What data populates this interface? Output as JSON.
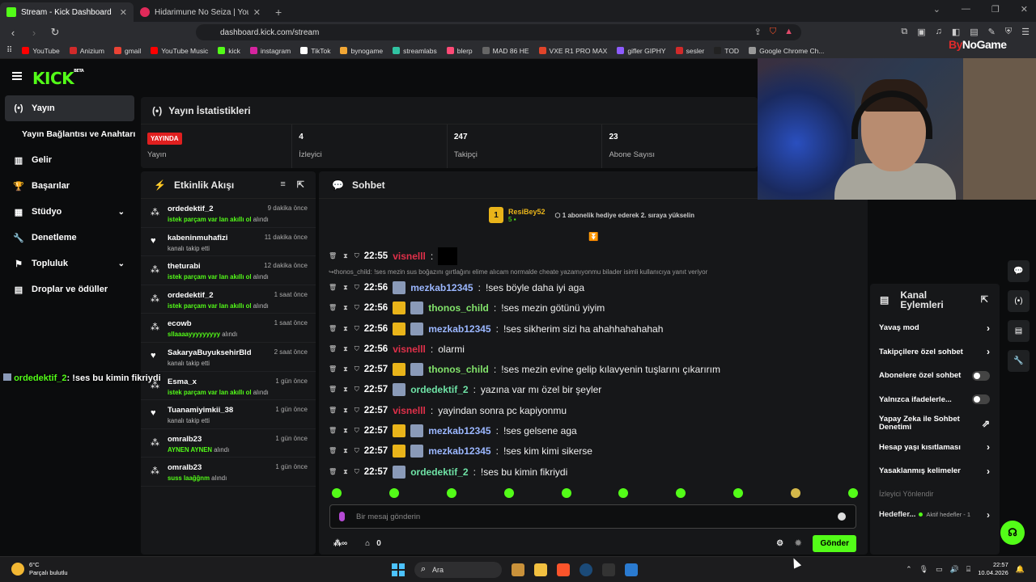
{
  "browser": {
    "tabs": [
      {
        "title": "Stream - Kick Dashboard",
        "active": true,
        "color": "#53fc18"
      },
      {
        "title": "Hidarimune No Seiza | YouTube M",
        "active": false,
        "color": "#e02a5a"
      }
    ],
    "url": "dashboard.kick.com/stream",
    "bookmarks": [
      {
        "label": "YouTube",
        "color": "#ff0000"
      },
      {
        "label": "Anizium",
        "color": "#d12a2a"
      },
      {
        "label": "gmail",
        "color": "#ea4335"
      },
      {
        "label": "YouTube Music",
        "color": "#ff0000"
      },
      {
        "label": "kick",
        "color": "#53fc18"
      },
      {
        "label": "instagram",
        "color": "#d6249f"
      },
      {
        "label": "TikTok",
        "color": "#ffffff"
      },
      {
        "label": "bynogame",
        "color": "#f2a735"
      },
      {
        "label": "streamlabs",
        "color": "#31c3a2"
      },
      {
        "label": "blerp",
        "color": "#ff4a76"
      },
      {
        "label": "MAD 86 HE",
        "color": "#666666"
      },
      {
        "label": "VXE R1 PRO MAX",
        "color": "#e0442a"
      },
      {
        "label": "gifler GIPHY",
        "color": "#8e5cff"
      },
      {
        "label": "sesler",
        "color": "#d12a2a"
      },
      {
        "label": "TOD",
        "color": "#222222"
      },
      {
        "label": "Google Chrome Ch...",
        "color": "#999999"
      }
    ]
  },
  "app": {
    "logo": "KICK",
    "logo_tag": "BETA",
    "sidebar": [
      {
        "label": "Yayın",
        "icon": "broadcast-icon",
        "active": true
      },
      {
        "label": "Yayın Bağlantısı ve Anahtarı",
        "icon": "",
        "sub": true
      },
      {
        "label": "Gelir",
        "icon": "revenue-icon"
      },
      {
        "label": "Başarılar",
        "icon": "trophy-icon"
      },
      {
        "label": "Stüdyo",
        "icon": "studio-icon",
        "chevron": true
      },
      {
        "label": "Denetleme",
        "icon": "wrench-icon"
      },
      {
        "label": "Topluluk",
        "icon": "community-icon",
        "chevron": true
      },
      {
        "label": "Droplar ve ödüller",
        "icon": "drops-icon"
      }
    ],
    "stats": {
      "title": "Yayın İstatistikleri",
      "live_badge": "YAYINDA",
      "live_label": "Yayın",
      "viewers": "4",
      "viewers_label": "İzleyici",
      "followers": "247",
      "followers_label": "Takipçi",
      "subs": "23",
      "subs_label": "Abone Sayısı"
    },
    "brand_overlay": {
      "by": "By",
      "rest": "NoGame"
    },
    "feed": {
      "title": "Etkinlik Akışı",
      "items": [
        {
          "name": "ordedektif_2",
          "time": "9 dakika önce",
          "icon": "reward",
          "desc_green": "istek parçam var lan akıllı ol",
          "desc": " alındı"
        },
        {
          "name": "kabeninmuhafizi",
          "time": "11 dakika önce",
          "icon": "heart",
          "desc_green": "",
          "desc": "kanalı takip etti"
        },
        {
          "name": "theturabi",
          "time": "12 dakika önce",
          "icon": "reward",
          "desc_green": "istek parçam var lan akıllı ol",
          "desc": " alındı"
        },
        {
          "name": "ordedektif_2",
          "time": "1 saat önce",
          "icon": "reward",
          "desc_green": "istek parçam var lan akıllı ol",
          "desc": " alındı"
        },
        {
          "name": "ecowb",
          "time": "1 saat önce",
          "icon": "reward",
          "desc_green": "sllaaaayyyyyyyyy",
          "desc": " alındı"
        },
        {
          "name": "SakaryaBuyuksehirBld",
          "time": "2 saat önce",
          "icon": "heart",
          "desc_green": "",
          "desc": "kanalı takip etti"
        },
        {
          "name": "Esma_x",
          "time": "1 gün önce",
          "icon": "reward",
          "desc_green": "istek parçam var lan akıllı ol",
          "desc": " alındı"
        },
        {
          "name": "Tuanamiyimkii_38",
          "time": "1 gün önce",
          "icon": "heart",
          "desc_green": "",
          "desc": "kanalı takip etti"
        },
        {
          "name": "omralb23",
          "time": "1 gün önce",
          "icon": "reward",
          "desc_green": "AYNEN AYNEN",
          "desc": " alındı"
        },
        {
          "name": "omralb23",
          "time": "1 gün önce",
          "icon": "reward",
          "desc_green": "suss laağğnm",
          "desc": " alındı"
        }
      ]
    },
    "chat": {
      "title": "Sohbet",
      "pinned": {
        "badge": "1",
        "name": "ResiBey52",
        "sub": "5",
        "message": "1 abonelik hediye ederek 2. sıraya yükselin"
      },
      "reply_note": "thonos_child: !ses mezin sus boğazını gırtlağını elime alıcam normalde cheate yazamıyonmu bilader isimli kullanıcıya yanıt veriyor",
      "messages": [
        {
          "time": "22:55",
          "user": "visnelll",
          "color": "#e0304a",
          "text": "",
          "badges": [],
          "black": true
        },
        {
          "time": "22:56",
          "user": "mezkab12345",
          "color": "#9bb7ff",
          "text": "!ses böyle daha iyi aga",
          "badges": [
            "av"
          ]
        },
        {
          "time": "22:56",
          "user": "thonos_child",
          "color": "#82e36b",
          "text": "!ses mezin götünü yiyim",
          "badges": [
            "crown",
            "av"
          ]
        },
        {
          "time": "22:56",
          "user": "mezkab12345",
          "color": "#9bb7ff",
          "text": "!ses sikherim sizi ha ahahhahahahah",
          "badges": [
            "crown",
            "av"
          ]
        },
        {
          "time": "22:56",
          "user": "visnelll",
          "color": "#e0304a",
          "text": "olarmi",
          "badges": []
        },
        {
          "time": "22:57",
          "user": "thonos_child",
          "color": "#82e36b",
          "text": "!ses mezin evine gelip kılavyenin tuşlarını çıkarırım",
          "badges": [
            "crown",
            "av"
          ]
        },
        {
          "time": "22:57",
          "user": "ordedektif_2",
          "color": "#6fe3a6",
          "text": "yazına var mı özel bir şeyler",
          "badges": [
            "av"
          ]
        },
        {
          "time": "22:57",
          "user": "visnelll",
          "color": "#e0304a",
          "text": "yayindan sonra pc kapiyonmu",
          "badges": []
        },
        {
          "time": "22:57",
          "user": "mezkab12345",
          "color": "#9bb7ff",
          "text": "!ses gelsene aga",
          "badges": [
            "crown",
            "av"
          ]
        },
        {
          "time": "22:57",
          "user": "mezkab12345",
          "color": "#9bb7ff",
          "text": "!ses kim kimi sikerse",
          "badges": [
            "crown",
            "av"
          ]
        },
        {
          "time": "22:57",
          "user": "ordedektif_2",
          "color": "#6fe3a6",
          "text": "!ses bu kimin fikriydi",
          "badges": [
            "av"
          ]
        }
      ],
      "placeholder": "Bir mesaj gönderin",
      "points": "0",
      "send": "Gönder"
    },
    "overlay_chat": {
      "user": "ordedektif_2",
      "text": ": !ses bu kimin fikriydi"
    },
    "actions": {
      "title_line1": "Kanal",
      "title_line2": "Eylemleri",
      "rows": [
        {
          "label": "Yavaş mod",
          "type": "chevron"
        },
        {
          "label": "Takipçilere özel sohbet",
          "type": "chevron"
        },
        {
          "label": "Abonelere özel sohbet",
          "type": "toggle"
        },
        {
          "label": "Yalnızca ifadelerle...",
          "type": "toggle"
        },
        {
          "label": "Yapay Zeka ile Sohbet Denetimi",
          "type": "external"
        },
        {
          "label": "Hesap yaşı kısıtlaması",
          "type": "chevron"
        },
        {
          "label": "Yasaklanmış kelimeler",
          "type": "chevron"
        }
      ],
      "section": "İzleyici Yönlendir",
      "goal_label": "Hedefler...",
      "goal_status": "Aktif hedefler - 1"
    }
  },
  "taskbar": {
    "temp": "6°C",
    "weather": "Parçalı bulutlu",
    "search": "Ara",
    "time": "22:57",
    "date": "10.04.2026"
  }
}
